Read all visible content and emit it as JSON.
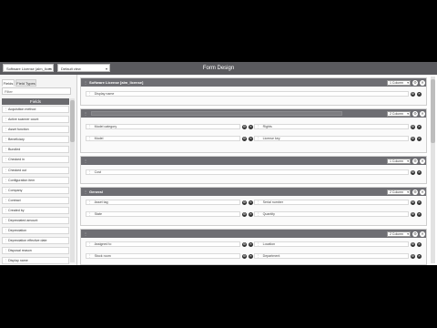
{
  "header": {
    "title": "Form Design",
    "select1": "Software License (alm_licen",
    "select2": "Default view"
  },
  "left": {
    "tabs": [
      "Fields",
      "Field Types"
    ],
    "filter_placeholder": "Filter",
    "fields_heading": "Fields",
    "items": [
      "Acquisition method",
      "Active scanner count",
      "Asset function",
      "Beneficiary",
      "Bundled",
      "Checked in",
      "Checked out",
      "Configuration item",
      "Company",
      "Contract",
      "Created by",
      "Depreciated amount",
      "Depreciation",
      "Depreciation effective date",
      "Disposal reason",
      "Display name"
    ]
  },
  "sections": [
    {
      "title": "Software License [alm_license]",
      "columns": "1 Column",
      "fields": [
        [
          "Display name"
        ]
      ]
    },
    {
      "title": "",
      "columns": "2 Column",
      "fields": [
        [
          "Model category",
          "Rights"
        ],
        [
          "Model",
          "License key"
        ]
      ]
    },
    {
      "title": "",
      "columns": "1 Column",
      "fields": [
        [
          "Cost"
        ]
      ]
    },
    {
      "title": "General",
      "columns": "2 Column",
      "fields": [
        [
          "Asset tag",
          "Serial number"
        ],
        [
          "State",
          "Quantity"
        ]
      ]
    },
    {
      "title": "",
      "columns": "2 Column",
      "fields": [
        [
          "Assigned to",
          "Location"
        ],
        [
          "Stock room",
          "Department"
        ]
      ]
    }
  ],
  "icons": {
    "grip": "drag-handle-icon",
    "settings": "gear-icon",
    "remove": "close-icon"
  }
}
